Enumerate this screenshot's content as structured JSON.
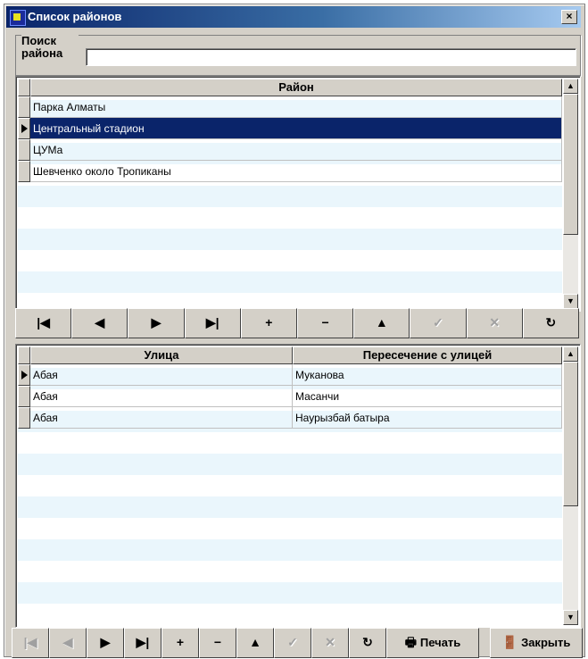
{
  "window": {
    "title": "Список районов",
    "close_glyph": "×"
  },
  "search": {
    "label": "Поиск района",
    "value": ""
  },
  "districts_grid": {
    "header": "Район",
    "selected_index": 1,
    "rows": [
      "Парка Алматы",
      "Центральный стадион",
      "ЦУМа",
      "Шевченко около Тропиканы"
    ]
  },
  "nav_top": [
    {
      "icon": "first-record-icon",
      "glyph": "|◀",
      "enabled": true
    },
    {
      "icon": "prior-record-icon",
      "glyph": "◀",
      "enabled": true
    },
    {
      "icon": "next-record-icon",
      "glyph": "▶",
      "enabled": true
    },
    {
      "icon": "last-record-icon",
      "glyph": "▶|",
      "enabled": true
    },
    {
      "icon": "insert-icon",
      "glyph": "+",
      "enabled": true
    },
    {
      "icon": "delete-icon",
      "glyph": "−",
      "enabled": true
    },
    {
      "icon": "edit-icon",
      "glyph": "▲",
      "enabled": true
    },
    {
      "icon": "post-icon",
      "glyph": "✓",
      "enabled": false
    },
    {
      "icon": "cancel-icon",
      "glyph": "✕",
      "enabled": false
    },
    {
      "icon": "refresh-icon",
      "glyph": "↻",
      "enabled": true
    }
  ],
  "streets_grid": {
    "headers": [
      "Улица",
      "Пересечение с улицей"
    ],
    "selected_index": 0,
    "rows": [
      [
        "Абая",
        "Муканова"
      ],
      [
        "Абая",
        "Масанчи"
      ],
      [
        "Абая",
        "Наурызбай батыра"
      ]
    ]
  },
  "nav_bottom": [
    {
      "icon": "first-record-icon",
      "glyph": "|◀",
      "enabled": false
    },
    {
      "icon": "prior-record-icon",
      "glyph": "◀",
      "enabled": false
    },
    {
      "icon": "next-record-icon",
      "glyph": "▶",
      "enabled": true
    },
    {
      "icon": "last-record-icon",
      "glyph": "▶|",
      "enabled": true
    },
    {
      "icon": "insert-icon",
      "glyph": "+",
      "enabled": true
    },
    {
      "icon": "delete-icon",
      "glyph": "−",
      "enabled": true
    },
    {
      "icon": "edit-icon",
      "glyph": "▲",
      "enabled": true
    },
    {
      "icon": "post-icon",
      "glyph": "✓",
      "enabled": false
    },
    {
      "icon": "cancel-icon",
      "glyph": "✕",
      "enabled": false
    },
    {
      "icon": "refresh-icon",
      "glyph": "↻",
      "enabled": true
    }
  ],
  "buttons": {
    "print": {
      "icon": "printer-icon",
      "glyph": "🖶",
      "label": "Печать"
    },
    "close": {
      "icon": "exit-door-icon",
      "glyph": "🚪",
      "label": "Закрыть"
    }
  },
  "colors": {
    "selection": "#0a246a",
    "face": "#d4d0c8",
    "alt_row": "#eaf6fc"
  }
}
